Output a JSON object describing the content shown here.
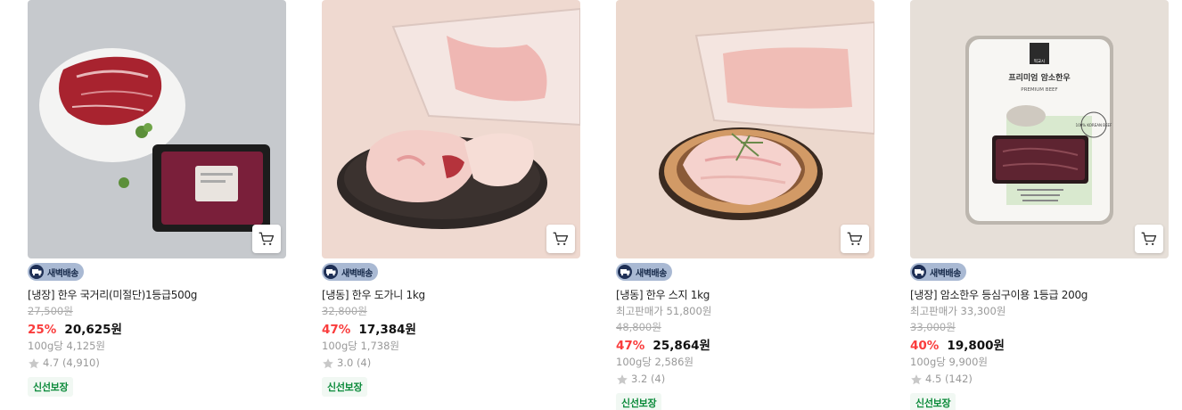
{
  "products": [
    {
      "badge": "새벽배송",
      "title": "[냉장] 한우 국거리(미절단)1등급500g",
      "max_price": null,
      "original_price": "27,500원",
      "discount": "25%",
      "price": "20,625원",
      "unit_price": "100g당 4,125원",
      "rating": "4.7 (4,910)",
      "tag": "신선보장"
    },
    {
      "badge": "새벽배송",
      "title": "[냉동] 한우 도가니 1kg",
      "max_price": null,
      "original_price": "32,800원",
      "discount": "47%",
      "price": "17,384원",
      "unit_price": "100g당 1,738원",
      "rating": "3.0 (4)",
      "tag": "신선보장"
    },
    {
      "badge": "새벽배송",
      "title": "[냉동] 한우 스지 1kg",
      "max_price": "최고판매가 51,800원",
      "original_price": "48,800원",
      "discount": "47%",
      "price": "25,864원",
      "unit_price": "100g당 2,586원",
      "rating": "3.2 (4)",
      "tag": "신선보장"
    },
    {
      "badge": "새벽배송",
      "title": "[냉장] 암소한우 등심구이용 1등급 200g",
      "max_price": "최고판매가 33,300원",
      "original_price": "33,000원",
      "discount": "40%",
      "price": "19,800원",
      "unit_price": "100g당 9,900원",
      "rating": "4.5 (142)",
      "tag": "신선보장",
      "package_text": {
        "brand": "떡교시",
        "name": "프리미엄 암소한우",
        "english": "PREMIUM BEEF",
        "seal": "100% KOREAN BEEF"
      }
    }
  ],
  "colors": {
    "discount": "#fa3c3c",
    "badge_bg": "#a9b9d3",
    "fresh_text": "#0b8a3a",
    "fresh_bg": "#f1f8f3"
  },
  "icons": [
    "truck-icon",
    "cart-icon",
    "star-icon"
  ]
}
